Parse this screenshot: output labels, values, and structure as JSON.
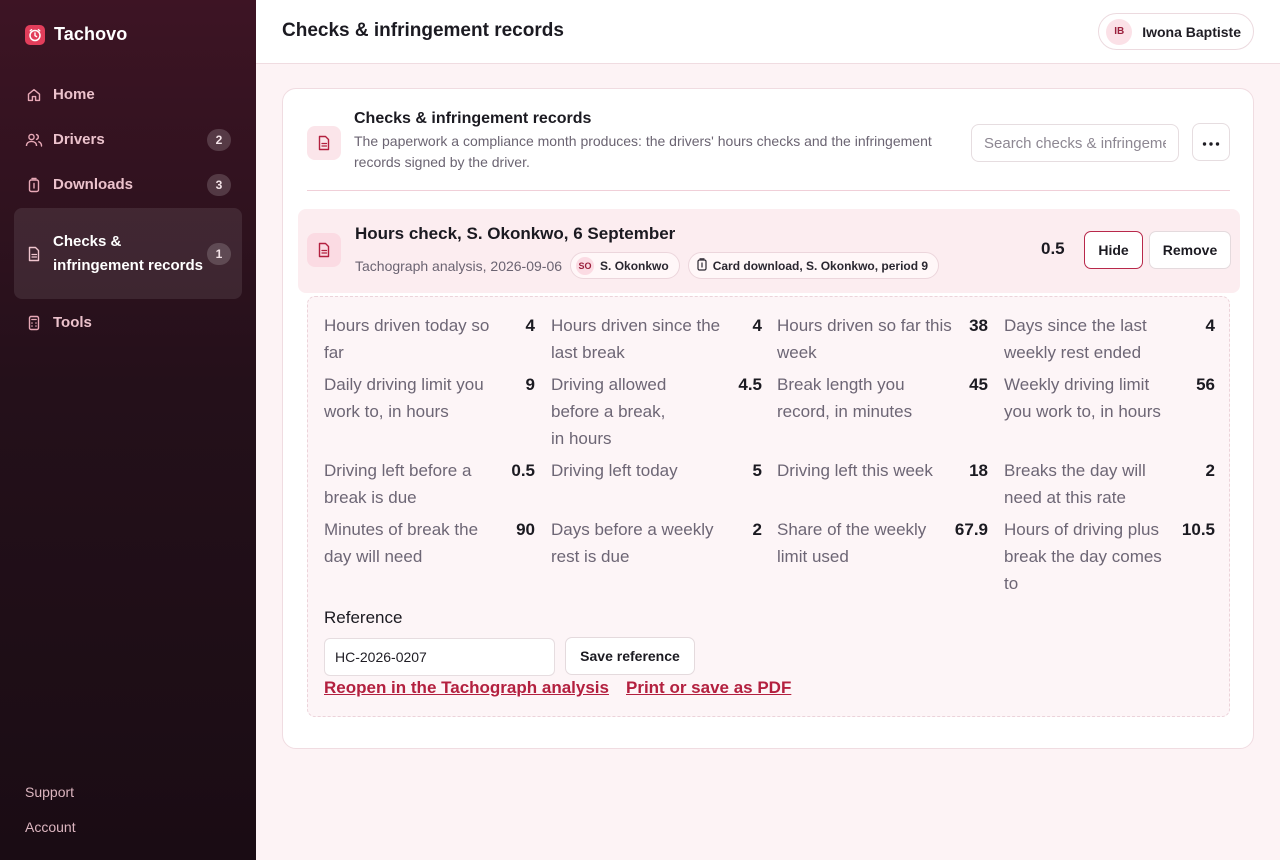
{
  "app": {
    "name": "Tachovo"
  },
  "colors": {
    "accent": "#b3203f",
    "brand": "#e23e5b",
    "sidebar_bg": "#2a0f1b",
    "page_bg": "#fdf3f5"
  },
  "sidebar": {
    "items": [
      {
        "label": "Home",
        "icon": "home-icon",
        "badge": null,
        "active": false
      },
      {
        "label": "Drivers",
        "icon": "users-icon",
        "badge": "2",
        "active": false
      },
      {
        "label": "Downloads",
        "icon": "card-icon",
        "badge": "3",
        "active": false
      },
      {
        "label": "Checks & infringement records",
        "icon": "document-icon",
        "badge": "1",
        "active": true
      },
      {
        "label": "Tools",
        "icon": "calculator-icon",
        "badge": null,
        "active": false
      }
    ],
    "footer": {
      "support": "Support",
      "account": "Account"
    }
  },
  "header": {
    "title": "Checks & infringement records",
    "user": {
      "initials": "IB",
      "name": "Iwona Baptiste"
    }
  },
  "card": {
    "title": "Checks & infringement records",
    "description": "The paperwork a compliance month produces: the drivers' hours checks and the infringement records signed by the driver.",
    "search_placeholder": "Search checks & infringement records",
    "search_value": ""
  },
  "record": {
    "title": "Hours check, S. Okonkwo, 6 September",
    "source": "Tachograph analysis, 2026-09-06",
    "driver": {
      "initials": "SO",
      "name": "S. Okonkwo"
    },
    "download": "Card download, S. Okonkwo, period 9",
    "value": "0.5",
    "hide_label": "Hide",
    "remove_label": "Remove",
    "metrics": [
      {
        "label": "Hours driven today so far",
        "value": "4"
      },
      {
        "label": "Hours driven since the last break",
        "value": "4"
      },
      {
        "label": "Hours driven so far this week",
        "value": "38"
      },
      {
        "label": "Days since the last weekly rest ended",
        "value": "4"
      },
      {
        "label": "Daily driving limit you work to, in hours",
        "value": "9"
      },
      {
        "label": "Driving allowed before a break, in hours",
        "value": "4.5"
      },
      {
        "label": "Break length you record, in minutes",
        "value": "45"
      },
      {
        "label": "Weekly driving limit you work to, in hours",
        "value": "56"
      },
      {
        "label": "Driving left before a break is due",
        "value": "0.5"
      },
      {
        "label": "Driving left today",
        "value": "5"
      },
      {
        "label": "Driving left this week",
        "value": "18"
      },
      {
        "label": "Breaks the day will need at this rate",
        "value": "2"
      },
      {
        "label": "Minutes of break the day will need",
        "value": "90"
      },
      {
        "label": "Days before a weekly rest is due",
        "value": "2"
      },
      {
        "label": "Share of the weekly limit used",
        "value": "67.9"
      },
      {
        "label": "Hours of driving plus break the day comes to",
        "value": "10.5"
      }
    ],
    "reference_label": "Reference",
    "reference_value": "HC-2026-0207",
    "save_reference_label": "Save reference",
    "reopen_link": "Reopen in the Tachograph analysis",
    "print_link": "Print or save as PDF"
  }
}
